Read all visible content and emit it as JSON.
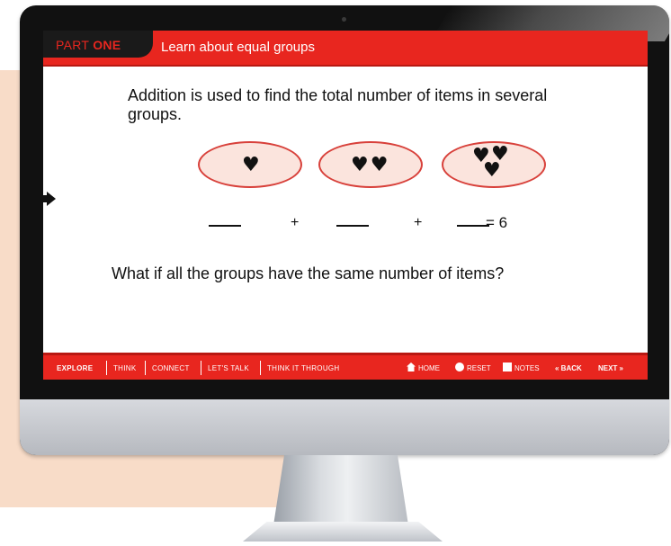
{
  "header": {
    "part_prefix": "PART",
    "part_number": "ONE",
    "title": "Learn about equal groups"
  },
  "main": {
    "intro": "Addition is used to find the total number of items in several groups.",
    "groups": [
      {
        "hearts": 1,
        "glyph": "♥"
      },
      {
        "hearts": 2,
        "glyph": "♥♥"
      },
      {
        "hearts": 3,
        "glyph": "♥"
      }
    ],
    "equation": {
      "plus1": "+",
      "plus2": "+",
      "equals": "= 6"
    },
    "question": "What if all the groups have the same number of items?"
  },
  "footer": {
    "tabs": [
      "EXPLORE",
      "THINK",
      "CONNECT",
      "LET'S TALK",
      "THINK IT THROUGH"
    ],
    "home": "HOME",
    "reset": "RESET",
    "notes": "NOTES",
    "back": "« BACK",
    "next": "NEXT »"
  },
  "colors": {
    "accent_red": "#e8261f",
    "oval_fill": "#fbe4dd",
    "peach_bg": "#f8dcc8"
  },
  "icons": {
    "home": "home-icon",
    "reset": "reset-icon",
    "notes": "notes-icon"
  }
}
